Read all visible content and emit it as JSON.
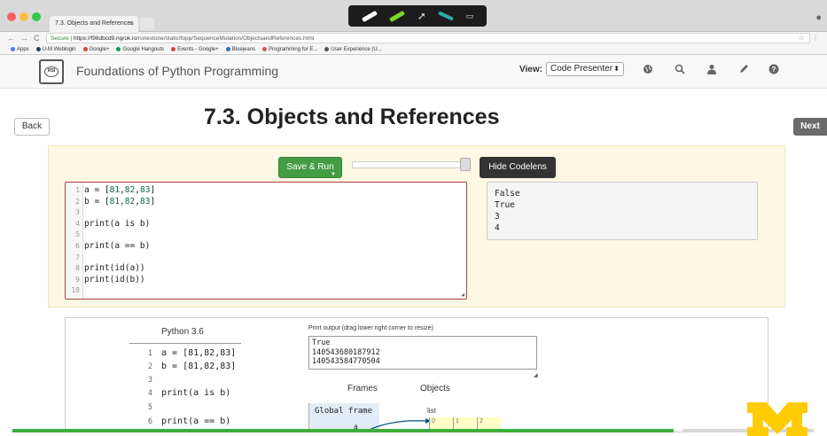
{
  "browser": {
    "tab_title": "7.3. Objects and References",
    "tab_close": "×",
    "url_secure": "Secure",
    "url_host": "https://f98dbcd9.ngrok.io",
    "url_path": "/runestone/static/fopp/SequenceMutation/ObjectsandReferences.html",
    "bookmarks": [
      {
        "label": "Apps",
        "color": "#4285f4"
      },
      {
        "label": "U-M Weblogin",
        "color": "#1c3d6e"
      },
      {
        "label": "Google+",
        "color": "#db4437"
      },
      {
        "label": "Google Hangouts",
        "color": "#0f9d58"
      },
      {
        "label": "Events - Google+",
        "color": "#db4437"
      },
      {
        "label": "Bluejeans",
        "color": "#2a6ebb"
      },
      {
        "label": "Programming for E...",
        "color": "#d9534f"
      },
      {
        "label": "User Experience (U...",
        "color": "#555555"
      }
    ]
  },
  "navbar": {
    "site_title": "Foundations of Python Programming",
    "logo_text": "RSI",
    "view_label": "View:",
    "view_value": "Code Presenter",
    "icons": [
      "globe-icon",
      "search-icon",
      "user-icon",
      "pencil-icon",
      "help-icon"
    ]
  },
  "page": {
    "title": "7.3. Objects and References",
    "back_label": "Back",
    "next_label": "Next"
  },
  "activecode": {
    "run_label": "Save & Run",
    "codelens_label": "Hide Codelens",
    "code_lines": [
      "a = [81,82,83]",
      "b = [81,82,83]",
      "",
      "print(a is b)",
      "",
      "print(a == b)",
      "",
      "print(id(a))",
      "print(id(b))",
      ""
    ],
    "output": "False\nTrue\n3\n4"
  },
  "codelens": {
    "python_version": "Python 3.6",
    "code_lines": [
      "a = [81,82,83]",
      "b = [81,82,83]",
      "",
      "print(a is b)",
      "",
      "print(a == b)"
    ],
    "print_output_label": "Print output (drag lower right corner to resize)",
    "print_output": "True\n140543680187912\n140543584770504",
    "frames_label": "Frames",
    "objects_label": "Objects",
    "global_frame_label": "Global frame",
    "var_a": "a",
    "object_type": "list",
    "list_indices": [
      "0",
      "1",
      "2"
    ]
  },
  "colors": {
    "run_green": "#449d44",
    "editor_border": "#a94442",
    "panel_bg": "#fcf8e3",
    "umich_maize": "#ffcb05"
  }
}
